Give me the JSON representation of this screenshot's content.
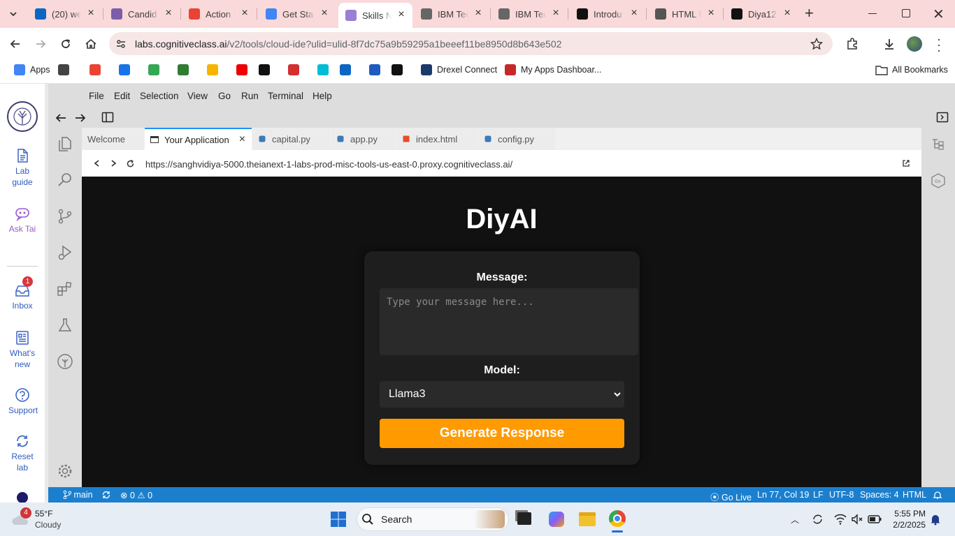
{
  "browser": {
    "tabs": [
      {
        "label": "(20) we",
        "icon": "linkedin-icon",
        "color": "#0a66c2"
      },
      {
        "label": "Candid",
        "icon": "candid-icon",
        "color": "#7b5ea7"
      },
      {
        "label": "Action I",
        "icon": "gmail-icon",
        "color": "#ea4335"
      },
      {
        "label": "Get Sta",
        "icon": "circle-icon",
        "color": "#4285f4"
      },
      {
        "label": "Skills N",
        "icon": "skills-network-icon",
        "color": "#9b7fd4"
      },
      {
        "label": "IBM Tec",
        "icon": "ibm-icon",
        "color": "#666666"
      },
      {
        "label": "IBM Tec",
        "icon": "ibm-icon",
        "color": "#666666"
      },
      {
        "label": "Introdu",
        "icon": "openai-icon",
        "color": "#111111"
      },
      {
        "label": "HTML U",
        "icon": "openai-icon",
        "color": "#555555"
      },
      {
        "label": "Diya12",
        "icon": "github-icon",
        "color": "#111111"
      }
    ],
    "new_tab": "+",
    "url_host": "labs.cognitiveclass.ai",
    "url_path": "/v2/tools/cloud-ide?ulid=ulid-8f7dc75a9b59295a1beeef11be8950d8b643e502",
    "bookmarks": [
      {
        "label": "Apps",
        "icon": "apps-grid-icon"
      },
      {
        "label": "",
        "icon": "grid-icon"
      },
      {
        "label": "",
        "icon": "gmail-icon"
      },
      {
        "label": "",
        "icon": "bookmark-p-icon"
      },
      {
        "label": "",
        "icon": "meet-icon"
      },
      {
        "label": "",
        "icon": "w-icon"
      },
      {
        "label": "",
        "icon": "co-icon"
      },
      {
        "label": "",
        "icon": "youtube-icon"
      },
      {
        "label": "",
        "icon": "x-icon"
      },
      {
        "label": "",
        "icon": "c-icon"
      },
      {
        "label": "",
        "icon": "bookmark-icon"
      },
      {
        "label": "",
        "icon": "linkedin-icon"
      },
      {
        "label": "",
        "icon": "word-icon"
      },
      {
        "label": "",
        "icon": "a-icon"
      },
      {
        "label": "Drexel Connect",
        "icon": "drexel-icon"
      },
      {
        "label": "My Apps Dashboar...",
        "icon": "myapps-icon"
      }
    ],
    "all_bookmarks": "All Bookmarks"
  },
  "lab": {
    "items": [
      {
        "label": "Lab guide",
        "icon": "document-icon"
      },
      {
        "label": "Ask Tai",
        "icon": "chat-bot-icon"
      },
      {
        "label": "Inbox",
        "icon": "inbox-icon",
        "badge": "1"
      },
      {
        "label": "What's new",
        "icon": "news-icon"
      },
      {
        "label": "Support",
        "icon": "help-icon"
      },
      {
        "label": "Reset lab",
        "icon": "reset-icon"
      }
    ]
  },
  "ide": {
    "menus": [
      "File",
      "Edit",
      "Selection",
      "View",
      "Go",
      "Run",
      "Terminal",
      "Help"
    ],
    "tabs": [
      {
        "label": "Welcome",
        "active": false
      },
      {
        "label": "Your Application",
        "active": true
      },
      {
        "label": "capital.py",
        "active": false
      },
      {
        "label": "app.py",
        "active": false
      },
      {
        "label": "index.html",
        "active": false
      },
      {
        "label": "config.py",
        "active": false
      }
    ],
    "preview_url": "https://sanghvidiya-5000.theianext-1-labs-prod-misc-tools-us-east-0.proxy.cognitiveclass.ai/"
  },
  "app": {
    "title": "DiyAI",
    "message_label": "Message:",
    "message_placeholder": "Type your message here...",
    "model_label": "Model:",
    "model_value": "Llama3",
    "generate_label": "Generate Response",
    "accent": "#ff9a00"
  },
  "status": {
    "branch": "main",
    "errors": "0",
    "warnings": "0",
    "go_live": "Go Live",
    "position": "Ln 77, Col 19",
    "eol": "LF",
    "encoding": "UTF-8",
    "spaces": "Spaces: 4",
    "language": "HTML",
    "bar_color": "#1b7fce"
  },
  "taskbar": {
    "temp": "55°F",
    "weather": "Cloudy",
    "weather_badge": "4",
    "search": "Search",
    "time": "5:55 PM",
    "date": "2/2/2025"
  }
}
